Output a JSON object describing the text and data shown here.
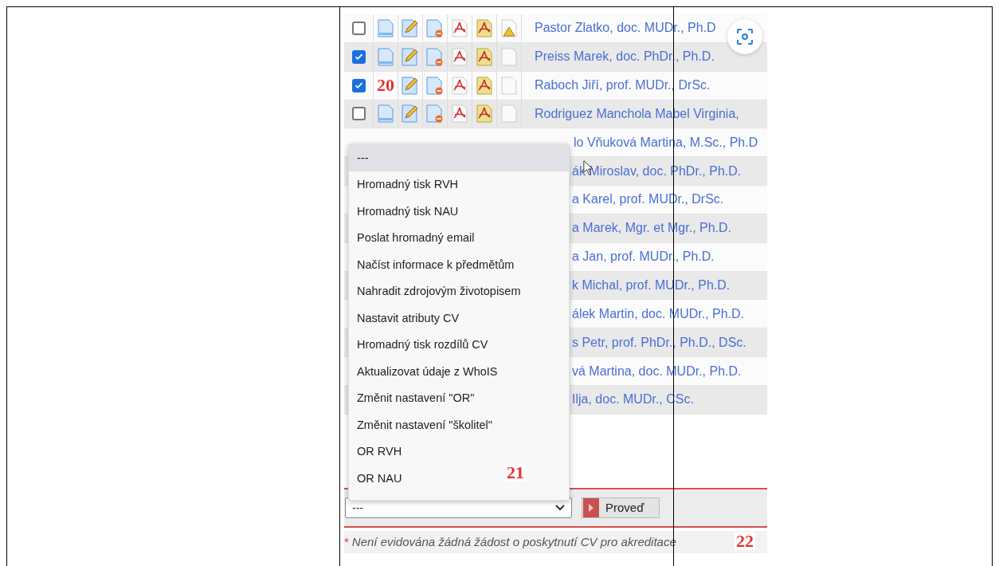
{
  "rows": [
    {
      "kind": "full",
      "checked": false,
      "warning": true,
      "name": "Pastor Zlatko, doc. MUDr., Ph.D"
    },
    {
      "kind": "full",
      "checked": true,
      "warning": false,
      "name": "Preiss Marek, doc. PhDr., Ph.D."
    },
    {
      "kind": "full",
      "checked": true,
      "warning": false,
      "callout": "20",
      "name": "Raboch Jiří, prof. MUDr., DrSc."
    },
    {
      "kind": "full",
      "checked": false,
      "warning": false,
      "name": "Rodriguez Manchola Mabel Virginia,"
    },
    {
      "kind": "partial",
      "name": "lo Vňuková Martina, M.Sc., Ph.D"
    },
    {
      "kind": "partial",
      "name": "ák Miroslav, doc. PhDr., Ph.D."
    },
    {
      "kind": "partial",
      "name": "a Karel, prof. MUDr., DrSc."
    },
    {
      "kind": "partial",
      "name": "a Marek, Mgr. et Mgr., Ph.D."
    },
    {
      "kind": "partial",
      "name": "a Jan, prof. MUDr., Ph.D."
    },
    {
      "kind": "partial",
      "name": "k Michal, prof. MUDr., Ph.D."
    },
    {
      "kind": "partial",
      "name": "álek Martin, doc. MUDr., Ph.D."
    },
    {
      "kind": "partial",
      "name": "s Petr, prof. PhDr., Ph.D., DSc."
    },
    {
      "kind": "partial",
      "name": "vá Martina, doc. MUDr., Ph.D."
    },
    {
      "kind": "partial",
      "name": "Ilja, doc. MUDr., CSc."
    }
  ],
  "menu": {
    "items": [
      {
        "label": "---",
        "selected": true
      },
      {
        "label": "Hromadný tisk RVH",
        "selected": false
      },
      {
        "label": "Hromadný tisk NAU",
        "selected": false
      },
      {
        "label": "Poslat hromadný email",
        "selected": false
      },
      {
        "label": "Načíst informace k předmětům",
        "selected": false
      },
      {
        "label": "Nahradit zdrojovým životopisem",
        "selected": false
      },
      {
        "label": "Nastavit atributy CV",
        "selected": false
      },
      {
        "label": "Hromadný tisk rozdílů CV",
        "selected": false
      },
      {
        "label": "Aktualizovat údaje z WhoIS",
        "selected": false
      },
      {
        "label": "Změnit nastavení \"OR\"",
        "selected": false
      },
      {
        "label": "Změnit nastavení \"školitel\"",
        "selected": false
      },
      {
        "label": "OR RVH",
        "selected": false
      },
      {
        "label": "OR NAU",
        "selected": false
      }
    ]
  },
  "action_select": {
    "value": "---"
  },
  "action_button": {
    "label": "Proveď"
  },
  "note": {
    "marker": "*",
    "text": "Není evidována žádná žádost o poskytnutí CV pro akreditace"
  },
  "callouts": [
    "21",
    "22"
  ]
}
